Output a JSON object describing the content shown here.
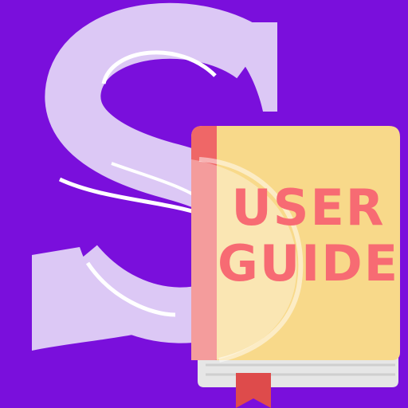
{
  "colors": {
    "background": "#7a0fdc",
    "letter": "#dcc8f5",
    "letter_highlight": "#ffffff",
    "book_cover": "#f8d98a",
    "book_spine": "#ef6767",
    "book_pages": "#e6e6e6",
    "book_pages_edge": "#cfcfcf",
    "bookmark": "#de4b4b",
    "title_text": "#f76b73"
  },
  "icons": {
    "letter": "decorative-letter-s-icon",
    "book": "user-guide-book-icon",
    "bookmark": "bookmark-ribbon-icon"
  },
  "book": {
    "title_line1": "USER",
    "title_line2": "GUIDE"
  }
}
